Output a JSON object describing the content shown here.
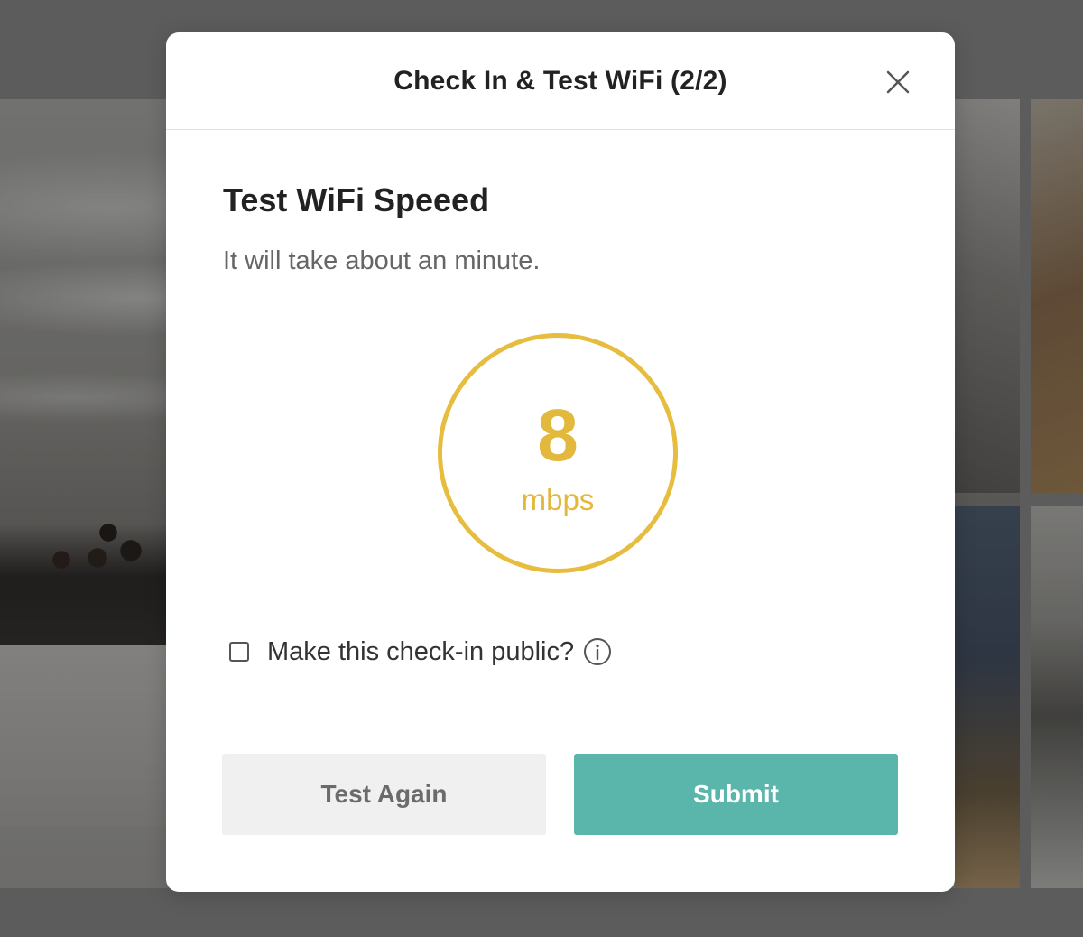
{
  "modal": {
    "title": "Check In & Test WiFi (2/2)",
    "close_icon": "close-icon"
  },
  "speed_test": {
    "heading": "Test WiFi Speeed",
    "subtitle": "It will take about an minute.",
    "value": "8",
    "unit": "mbps",
    "accent_color": "#e6bd3e"
  },
  "public_checkin": {
    "label": "Make this check-in public?",
    "checked": false,
    "info_icon": "info-icon"
  },
  "actions": {
    "test_again_label": "Test Again",
    "submit_label": "Submit",
    "submit_color": "#5ab5ab"
  }
}
